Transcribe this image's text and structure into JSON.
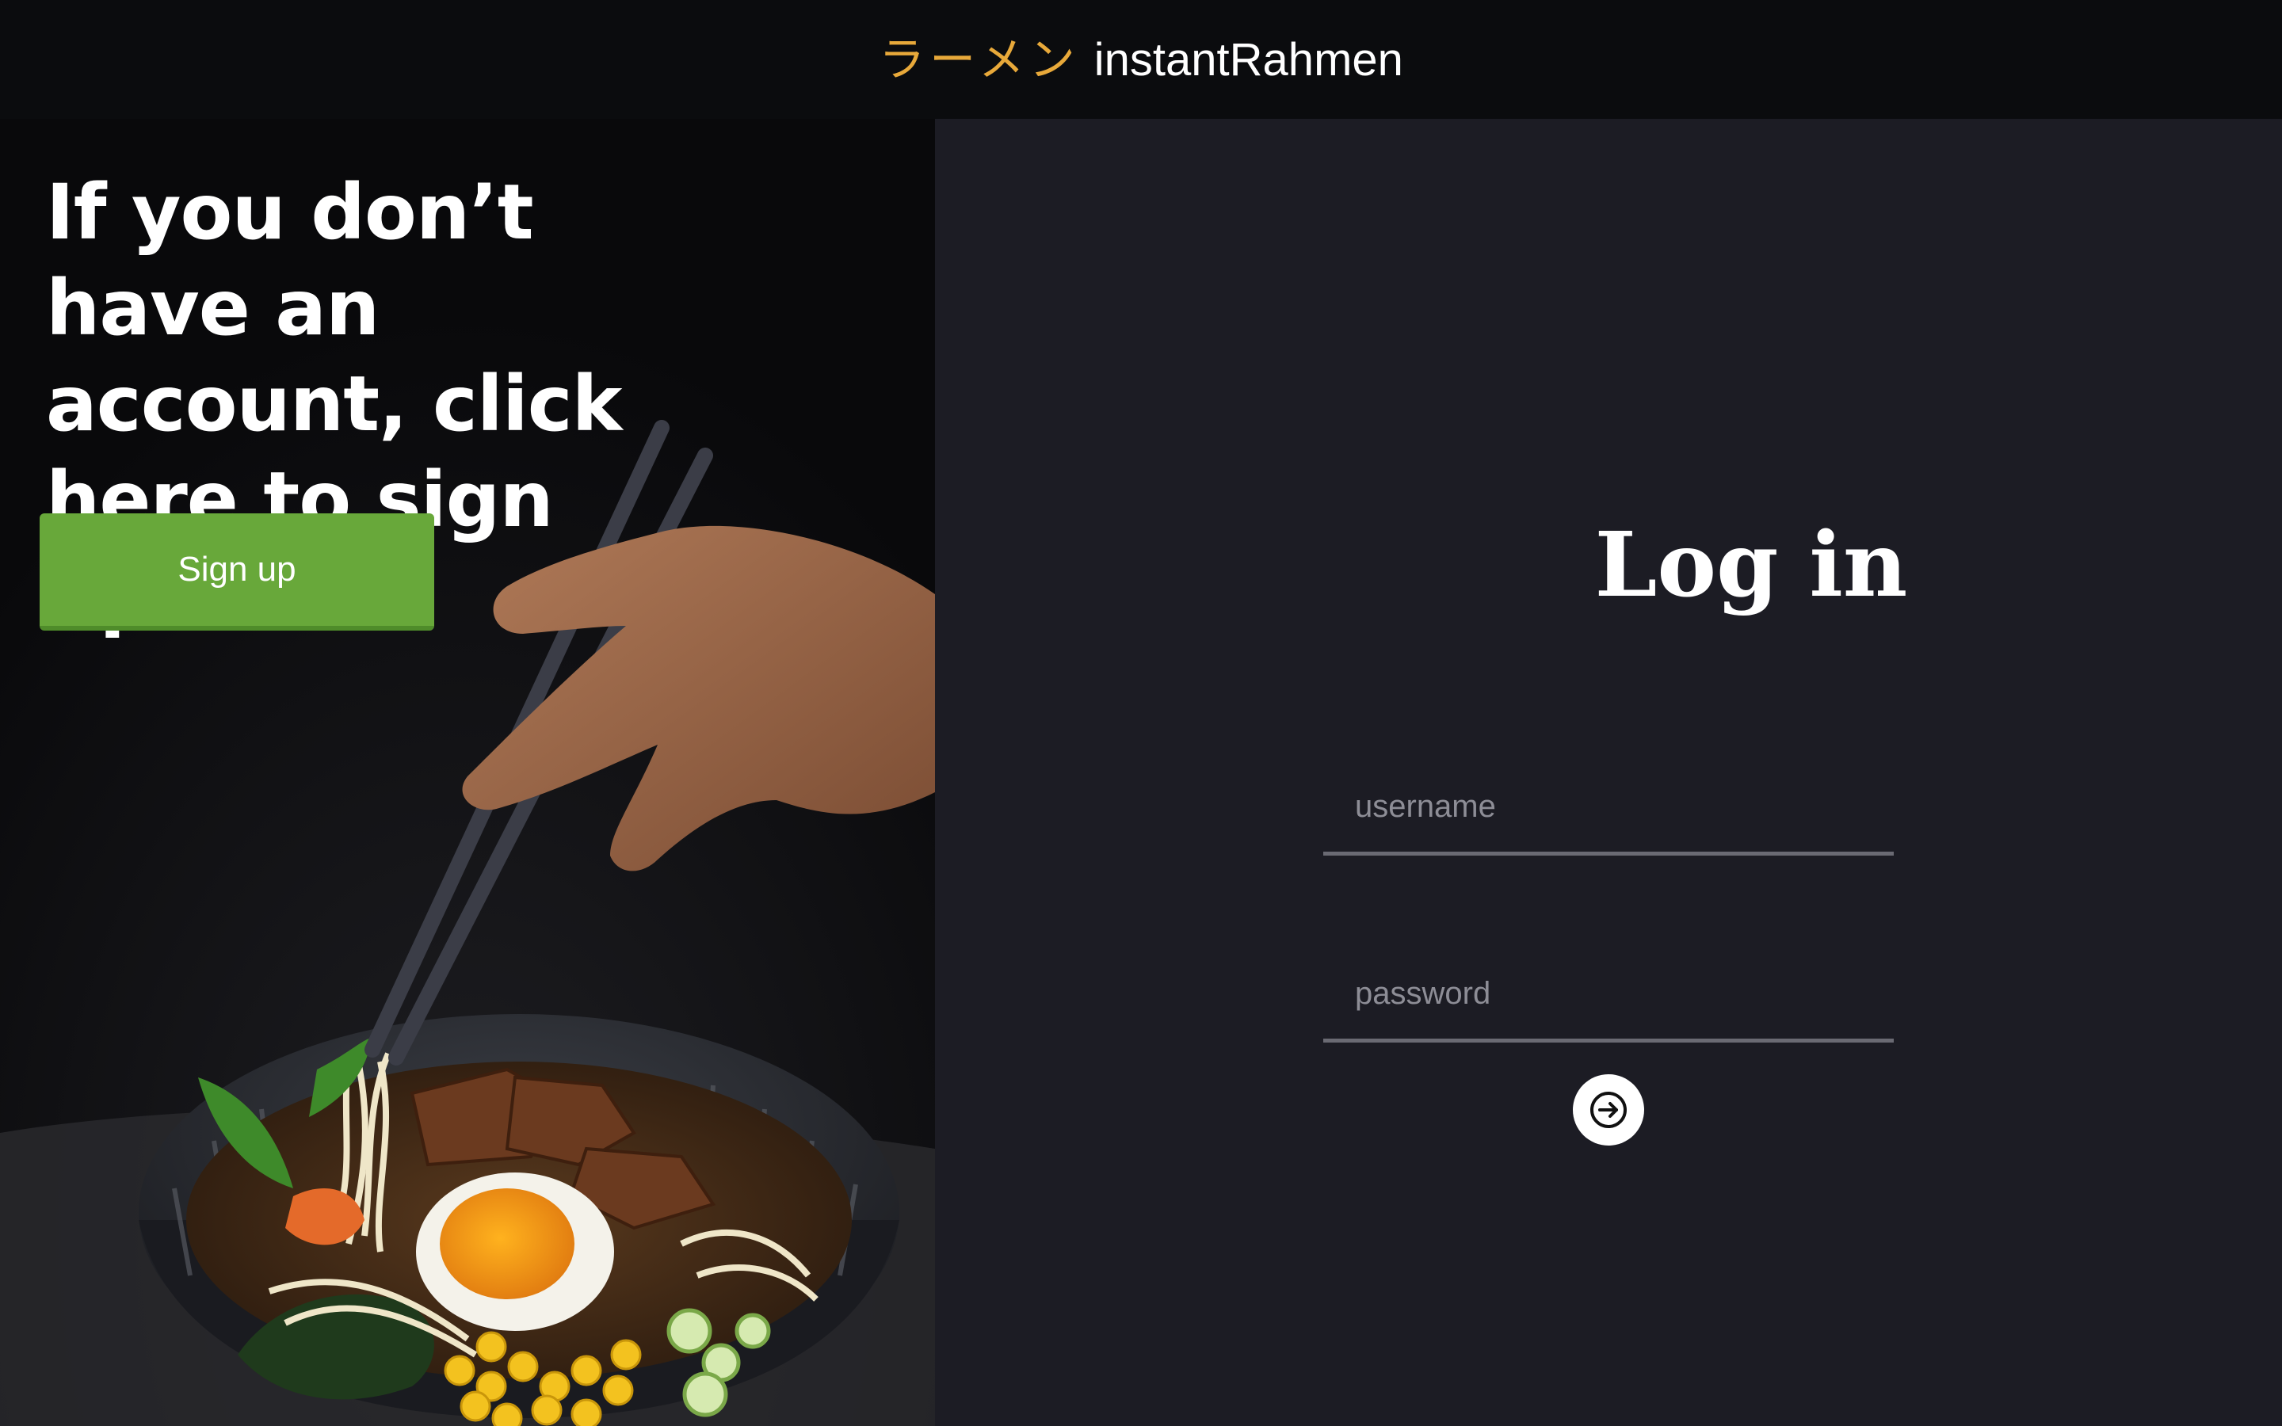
{
  "header": {
    "brand_japanese": "ラーメン",
    "brand_name": "instantRahmen"
  },
  "signup_panel": {
    "headline": "If you don’t have an account, click here to sign up.",
    "signup_label": "Sign up",
    "background_image": "ramen-bowl-with-chopsticks"
  },
  "login": {
    "title": "Log in",
    "username_placeholder": "username",
    "password_placeholder": "password",
    "submit_icon": "arrow-right-circle-icon"
  },
  "colors": {
    "brand_accent": "#e8a93a",
    "signup_green": "#68a83a",
    "page_background": "#1c1c24"
  }
}
